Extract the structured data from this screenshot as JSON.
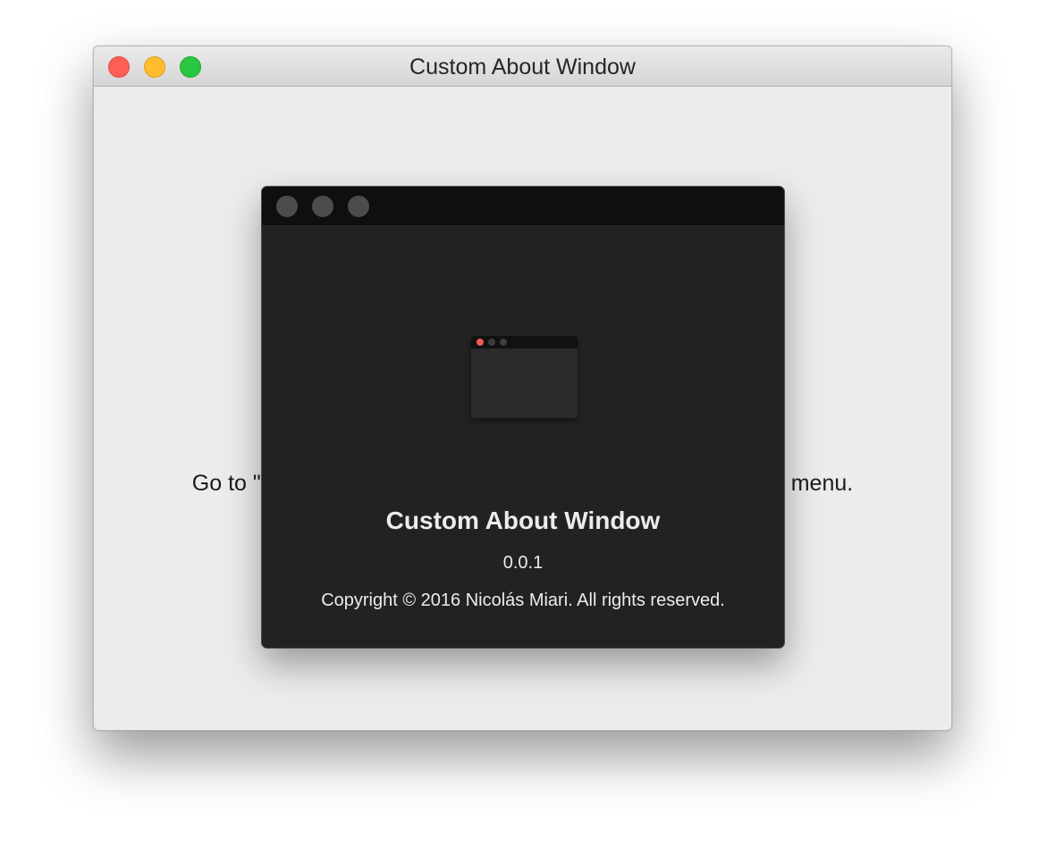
{
  "main_window": {
    "title": "Custom About Window",
    "instruction_left": "Go to \"",
    "instruction_right": " menu."
  },
  "about_window": {
    "app_name": "Custom About Window",
    "version": "0.0.1",
    "copyright": "Copyright © 2016 Nicolás Miari. All rights reserved.",
    "icon": "window-app-icon"
  },
  "colors": {
    "close": "#fd5f57",
    "minimize": "#febc2e",
    "zoom": "#29c740",
    "about_background": "#222222",
    "about_titlebar": "#0f0f0f"
  }
}
